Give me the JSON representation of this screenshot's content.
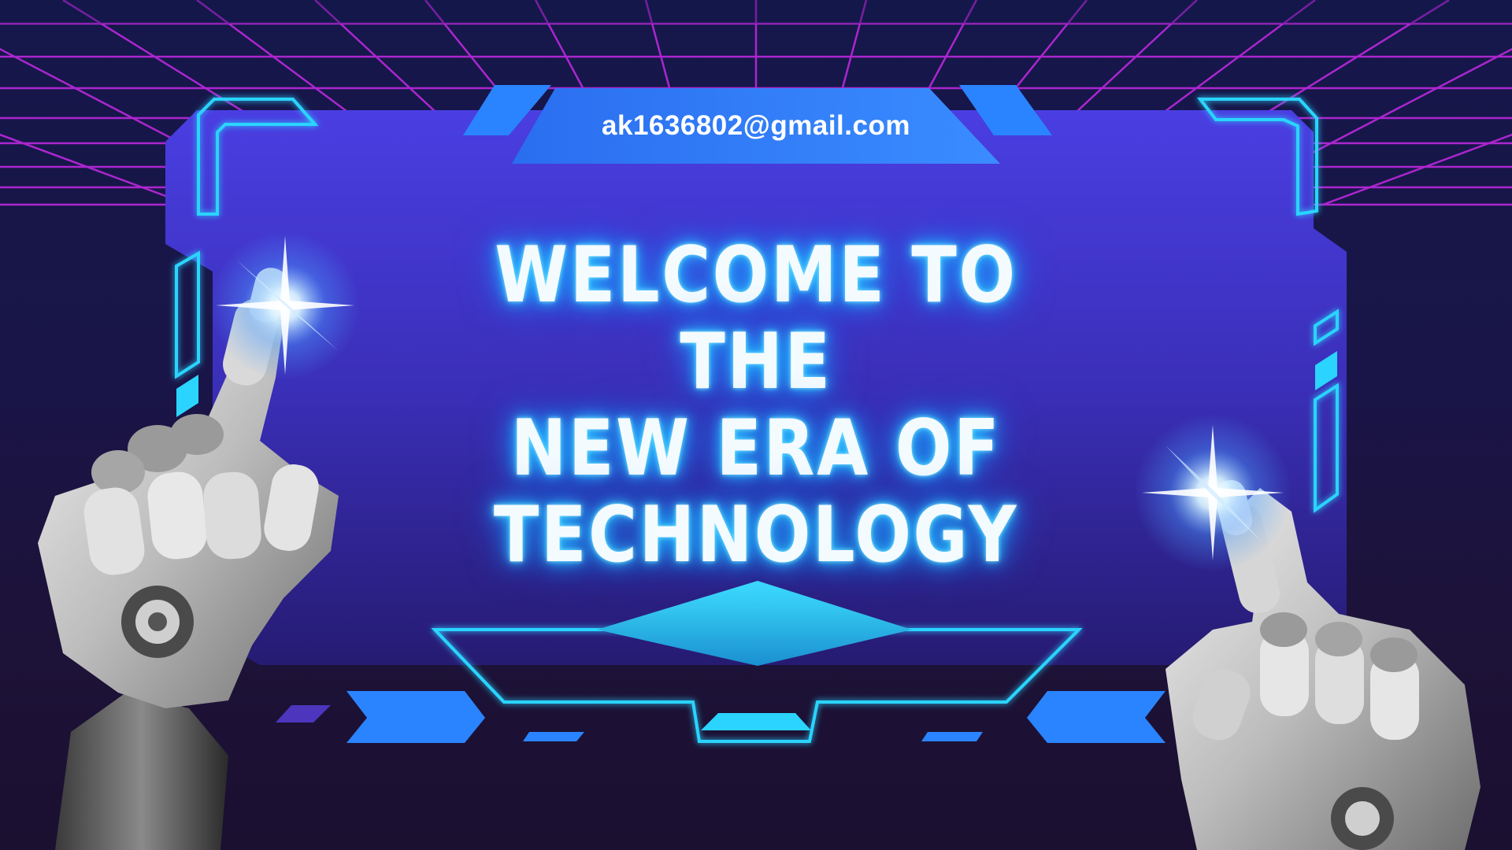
{
  "email": "ak1636802@gmail.com",
  "headline": {
    "lines": [
      "WELCOME TO THE",
      "NEW ERA OF",
      "TECHNOLOGY"
    ]
  },
  "colors": {
    "background_top": "#15174a",
    "background_bottom": "#1b1030",
    "grid_line": "#b327d6",
    "panel_top": "#4b3fe0",
    "panel_bottom": "#2a1f7a",
    "cyan_accent": "#2ad4ff",
    "blue_accent": "#1f7bff",
    "headline_glow": "#2fc8ff"
  },
  "icons": {
    "left_hand": "robot-hand-icon",
    "right_hand": "robot-hand-icon",
    "sparkle": "light-flare-icon"
  }
}
